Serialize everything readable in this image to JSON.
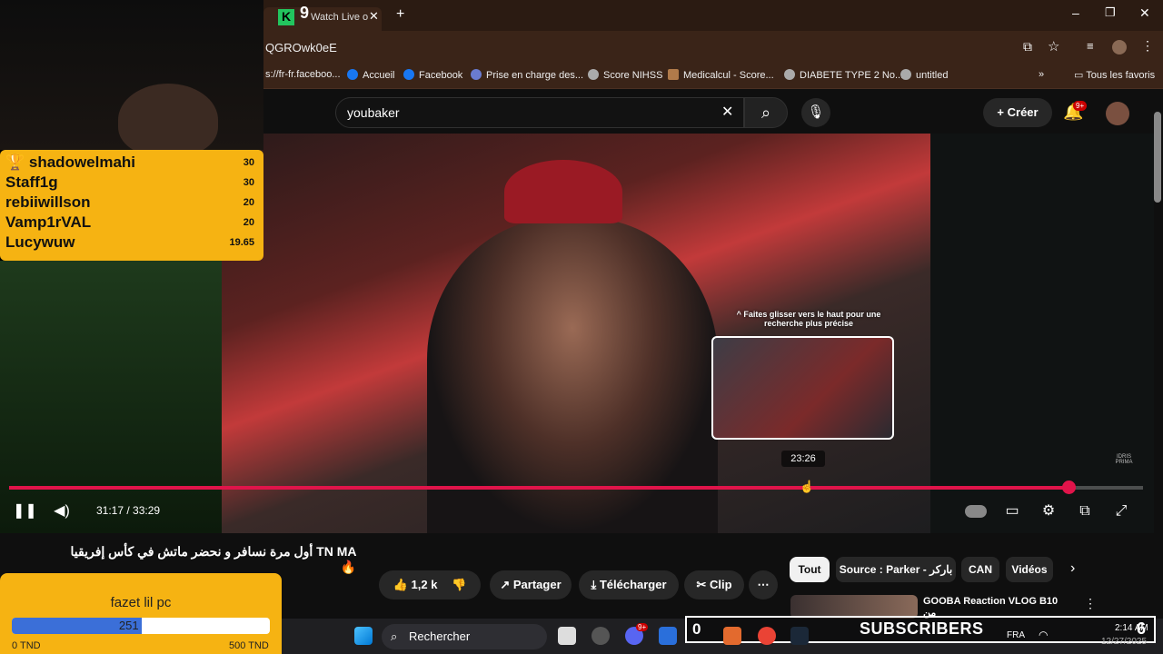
{
  "browser": {
    "tab_title": "Watch Live o",
    "tab_badge": "9",
    "url_fragment": "QGROwk0eE",
    "bookmarks": [
      "s://fr-fr.faceboo...",
      "Accueil",
      "Facebook",
      "Prise en charge des...",
      "Score NIHSS",
      "Medicalcul - Score...",
      "DIABETE TYPE 2 No...",
      "untitled"
    ],
    "all_bookmarks": "Tous les favoris"
  },
  "youtube": {
    "search_value": "youbaker",
    "create_label": "Créer",
    "notif_count": "9+"
  },
  "leaderboard": [
    {
      "name": "shadowelmahi",
      "score": "30"
    },
    {
      "name": "Staff1g",
      "score": "30"
    },
    {
      "name": "rebiiwillson",
      "score": "20"
    },
    {
      "name": "Vamp1rVAL",
      "score": "20"
    },
    {
      "name": "Lucywuw",
      "score": "19.65"
    }
  ],
  "player": {
    "preview_hint": "^ Faites glisser vers le haut pour une recherche plus précise",
    "preview_time": "23:26",
    "time_display": "31:17 / 33:29",
    "progress": 0.934,
    "hover_fraction": 0.703,
    "watermark": "IDRIS PRIMA"
  },
  "video": {
    "title": "أول مرة نسافر و نحضر ماتش في كأس إفريقيا TN MA",
    "likes": "1,2 k",
    "share_label": "Partager",
    "download_label": "Télécharger",
    "clip_label": "Clip"
  },
  "chips": [
    "Tout",
    "Source : Parker - باركر",
    "CAN",
    "Vidéos"
  ],
  "recommendation": {
    "title": "GOOBA Reaction VLOG B10 من"
  },
  "goal": {
    "name": "fazet lil pc",
    "current": "251",
    "min": "0 TND",
    "max": "500 TND",
    "fraction": 0.502
  },
  "taskbar": {
    "search_placeholder": "Rechercher",
    "lang": "FRA",
    "time": "2:14 AM",
    "date": "12/27/2025",
    "badge": "9+"
  },
  "subscribers": {
    "count": "0",
    "label": "SUBSCRIBERS",
    "goal": "6"
  },
  "colors": {
    "accent": "#e0144a",
    "widget": "#f6b312",
    "goal_fill": "#3b6fd8"
  }
}
